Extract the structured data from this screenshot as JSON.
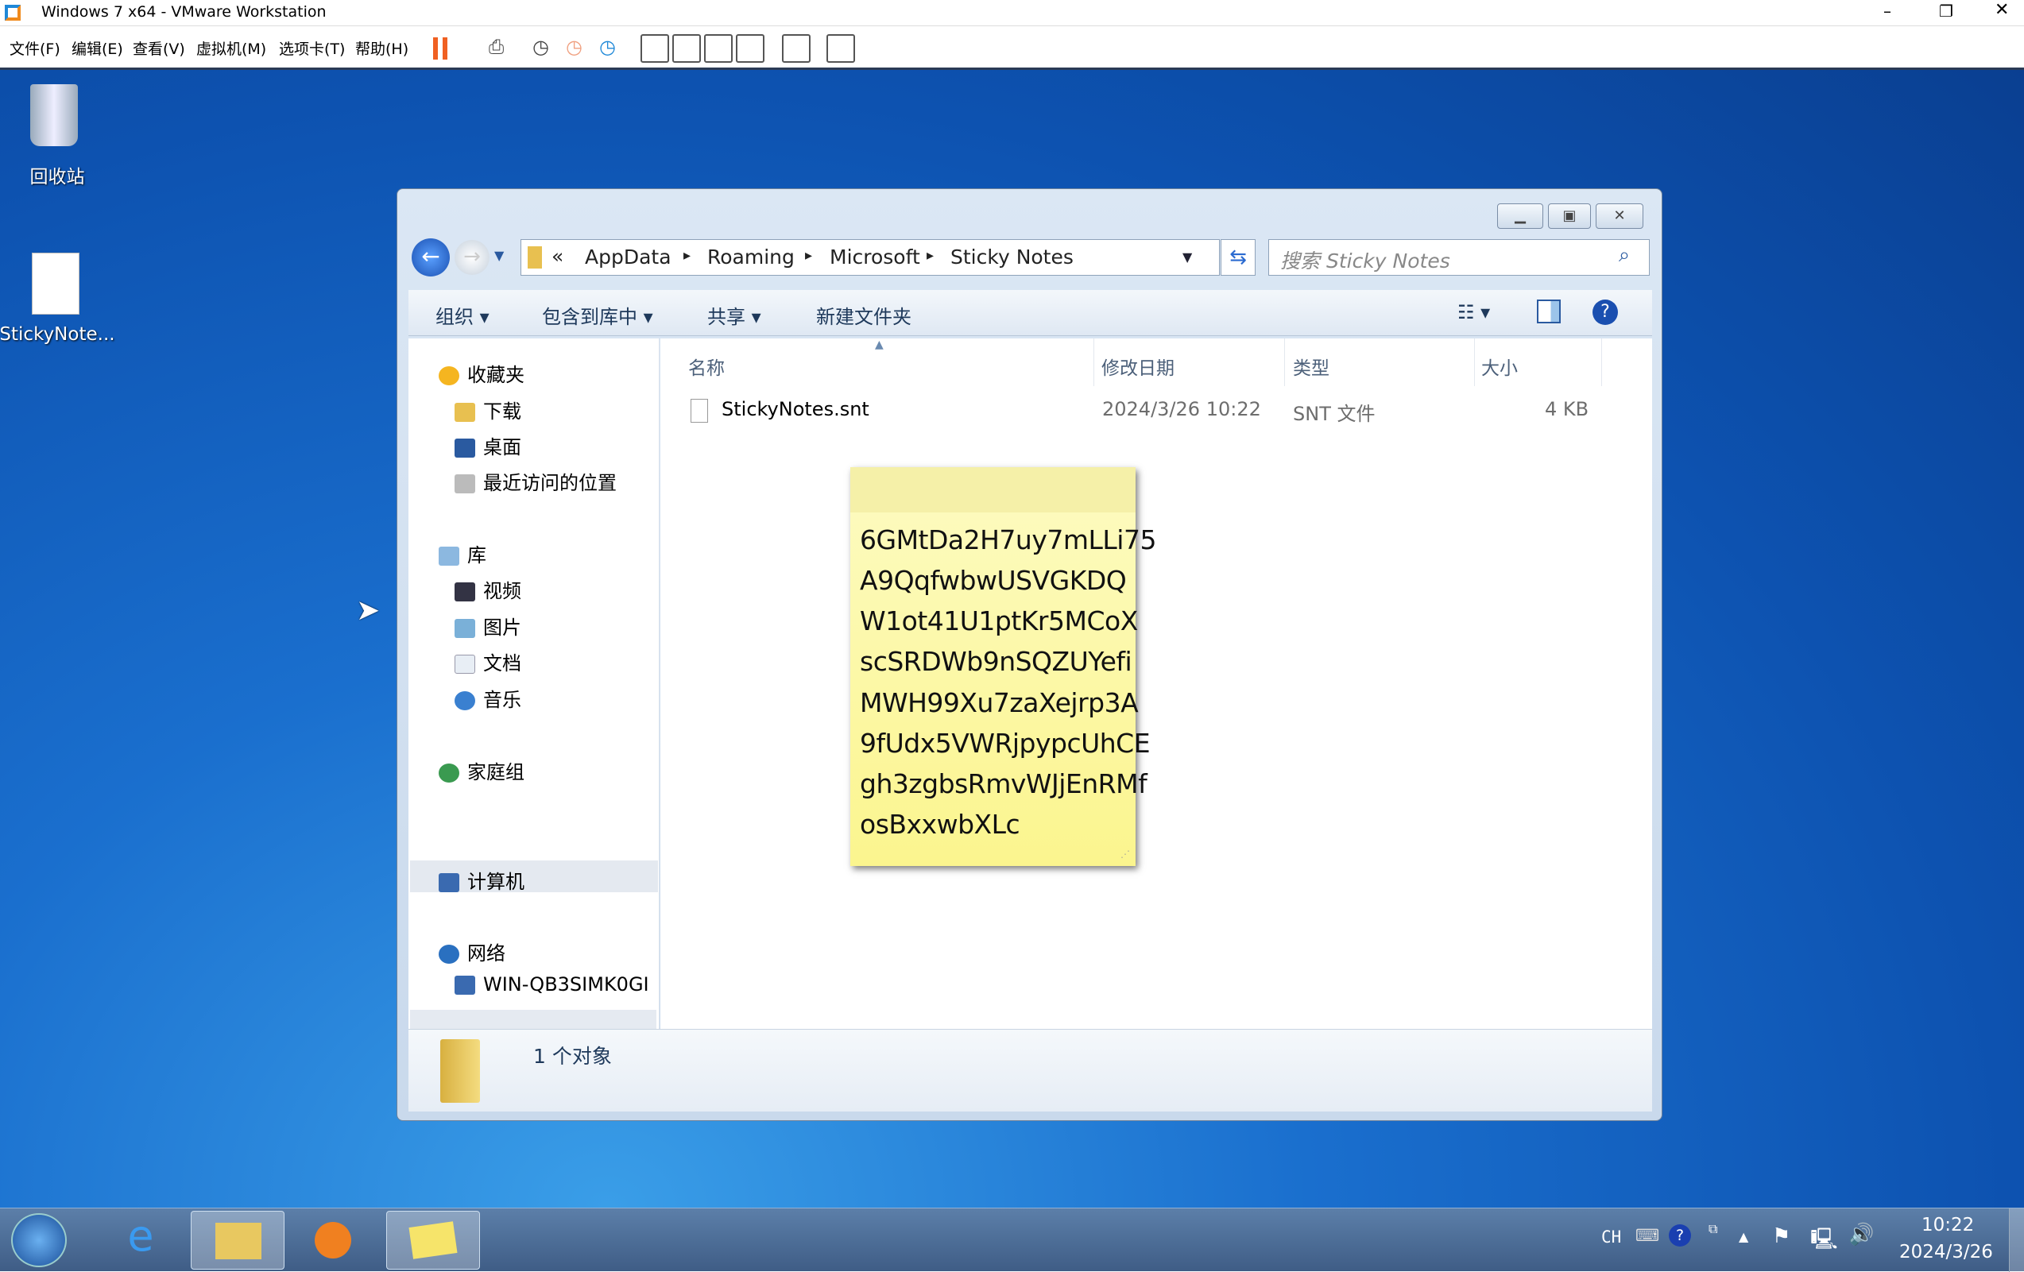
{
  "vmware": {
    "title": "Windows 7 x64 - VMware Workstation",
    "menu": [
      "文件(F)",
      "编辑(E)",
      "查看(V)",
      "虚拟机(M)",
      "选项卡(T)",
      "帮助(H)"
    ]
  },
  "desktop": {
    "icons": [
      {
        "label": "回收站"
      },
      {
        "label": "StickyNote..."
      }
    ]
  },
  "explorer": {
    "breadcrumb": [
      "AppData",
      "Roaming",
      "Microsoft",
      "Sticky Notes"
    ],
    "breadcrumb_prefix": "«",
    "search_placeholder": "搜索 Sticky Notes",
    "toolbar": {
      "organize": "组织",
      "include": "包含到库中",
      "share": "共享",
      "new_folder": "新建文件夹"
    },
    "nav": {
      "favorites": "收藏夹",
      "downloads": "下载",
      "desktop": "桌面",
      "recent": "最近访问的位置",
      "libraries": "库",
      "videos": "视频",
      "pictures": "图片",
      "documents": "文档",
      "music": "音乐",
      "homegroup": "家庭组",
      "computer": "计算机",
      "network": "网络",
      "host": "WIN-QB3SIMK0GI"
    },
    "columns": [
      "名称",
      "修改日期",
      "类型",
      "大小"
    ],
    "files": [
      {
        "name": "StickyNotes.snt",
        "modified": "2024/3/26 10:22",
        "type": "SNT 文件",
        "size": "4 KB"
      }
    ],
    "status": "1 个对象"
  },
  "sticky_note": {
    "lines": [
      "6GMtDa2H7uy7mLLi75",
      "A9QqfwbwUSVGKDQ",
      "W1ot41U1ptKr5MCoX",
      "scSRDWb9nSQZUYefi",
      "MWH99Xu7zaXejrp3A",
      "9fUdx5VWRjpypcUhCE",
      "gh3zgbsRmvWJjEnRMf",
      "osBxxwbXLc"
    ]
  },
  "taskbar": {
    "lang": "CH",
    "time": "10:22",
    "date": "2024/3/26"
  }
}
